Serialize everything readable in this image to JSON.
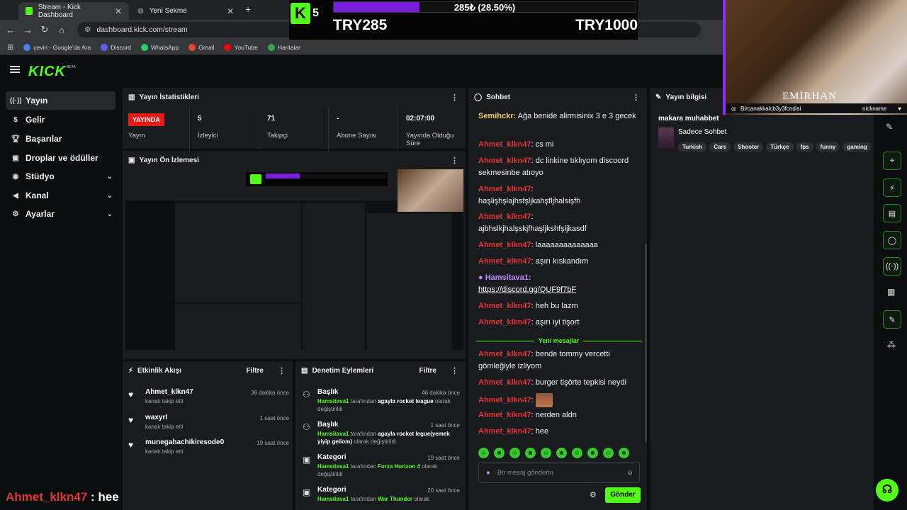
{
  "browser": {
    "tabs": [
      {
        "label": "Stream - Kick Dashboard",
        "active": true
      },
      {
        "label": "Yeni Sekme",
        "active": false
      }
    ],
    "url": "dashboard.kick.com/stream",
    "bookmarks": [
      "çeviri - Google'da Ara",
      "Discord",
      "WhatsApp",
      "Gmail",
      "YouTube",
      "Haritalar"
    ]
  },
  "overlay": {
    "kick_count": "5",
    "goal_text": "285₺ (28.50%)",
    "goal_progress_pct": 28.5,
    "goal_start": "TRY285",
    "goal_end": "TRY1000",
    "cam_name": "EMİRHAN",
    "cam_left": "Bircanakkalcb3y3fcndisi",
    "cam_right": "nickname"
  },
  "sidebar": {
    "items": [
      {
        "label": "Yayın",
        "icon": "broadcast-icon",
        "active": true,
        "chevron": false
      },
      {
        "label": "Gelir",
        "icon": "money-icon",
        "chevron": false
      },
      {
        "label": "Başarılar",
        "icon": "trophy-icon",
        "chevron": false
      },
      {
        "label": "Droplar ve ödüller",
        "icon": "gift-icon",
        "chevron": false
      },
      {
        "label": "Stüdyo",
        "icon": "camera-icon",
        "chevron": true
      },
      {
        "label": "Kanal",
        "icon": "megaphone-icon",
        "chevron": true
      },
      {
        "label": "Ayarlar",
        "icon": "gear-icon",
        "chevron": true
      }
    ]
  },
  "stats": {
    "title": "Yayın İstatistikleri",
    "live_badge": "YAYINDA",
    "live_label": "Yayın",
    "viewers_value": "5",
    "viewers_label": "İzleyici",
    "followers_value": "71",
    "followers_label": "Takipçi",
    "subs_value": "-",
    "subs_label": "Abone Sayısı",
    "uptime_value": "02:07:00",
    "uptime_label": "Yayında Olduğu Süre"
  },
  "preview": {
    "title": "Yayın Ön İzlemesi"
  },
  "activity": {
    "title": "Etkinlik Akışı",
    "filter": "Filtre",
    "items": [
      {
        "name": "Ahmet_klkn47",
        "sub": "kanalı takip etti",
        "time": "36 dakika önce"
      },
      {
        "name": "waxyrl",
        "sub": "kanalı takip etti",
        "time": "1 saat önce"
      },
      {
        "name": "munegahachikiresode0",
        "sub": "kanalı takip etti",
        "time": "19 saat önce"
      }
    ]
  },
  "moderation": {
    "title": "Denetim Eylemleri",
    "filter": "Filtre",
    "items": [
      {
        "title": "Başlık",
        "time": "46 dakika önce",
        "user": "Hamsitava1",
        "mid": " tarafından ",
        "value": "agayla rocket league",
        "end": " olarak değiştirildi"
      },
      {
        "title": "Başlık",
        "time": "1 saat önce",
        "user": "Hamsitava1",
        "mid": " tarafından ",
        "value": "agayla rocket legue(yemek yiyip geliom)",
        "end": " olarak değiştirildi"
      },
      {
        "title": "Kategori",
        "time": "19 saat önce",
        "user": "Hamsitava1",
        "mid": " tarafından ",
        "value": "Forza Horizon 4",
        "end": " olarak değiştirildi"
      },
      {
        "title": "Kategori",
        "time": "20 saat önce",
        "user": "Hamsitava1",
        "mid": " tarafından ",
        "value": "War Thunder",
        "end": " olarak"
      }
    ]
  },
  "chat": {
    "title": "Sohbet",
    "messages": [
      {
        "user": "Semihckr",
        "text": " Ağa benide alirmisinix 3 e 3 gecek"
      },
      {
        "user": "Ahmet_klkn47",
        "text": " cs mi"
      },
      {
        "user": "Ahmet_klkn47",
        "text": " dc linkine tıklıyom discoord sekmesinbe atıoyo"
      },
      {
        "user": "Ahmet_klkn47",
        "text": " haşlişhşlajhsfşljkahşfljhalsişfh"
      },
      {
        "user": "Ahmet_klkn47",
        "text": " ajbhslkjhalşskjfhaşljkshfşljkasdf"
      },
      {
        "user": "Ahmet_klkn47",
        "text": " laaaaaaaaaaaaaa"
      },
      {
        "user": "Ahmet_klkn47",
        "text": " aşırı kıskandım"
      },
      {
        "user": "Hamsitava1",
        "text": "https://discord.gg/QUF9f7bF"
      },
      {
        "user": "Ahmet_klkn47",
        "text": " heh bu lazm"
      },
      {
        "user": "Ahmet_klkn47",
        "text": " aşırı iyi tişort"
      },
      {
        "user": "Ahmet_klkn47",
        "text": " bende tommy vercetti gömleğiyle izliyom"
      },
      {
        "user": "Ahmet_klkn47",
        "text": " burger tişörte tepkisi neydi"
      },
      {
        "user": "Ahmet_klkn47",
        "text": ""
      },
      {
        "user": "Ahmet_klkn47",
        "text": " nerden aldn"
      },
      {
        "user": "Ahmet_klkn47",
        "text": " hee"
      }
    ],
    "new_messages": "Yeni mesajlar",
    "placeholder": "Bir mesaj gönderin",
    "send": "Gönder"
  },
  "info": {
    "title": "Yayın bilgisi",
    "stream_title": "makara muhabbet",
    "category": "Sadece Sohbet",
    "tags": [
      "Turkish",
      "Cars",
      "Shooter",
      "Türkçe",
      "fps",
      "funny",
      "gaming"
    ]
  },
  "bottom_overlay": {
    "user": "Ahmet_klkn47",
    "text": " : hee"
  },
  "colors": {
    "brand": "#53fc18",
    "live": "#e91916",
    "username": "#e33535",
    "goal_fill": "#7b1fdf"
  }
}
